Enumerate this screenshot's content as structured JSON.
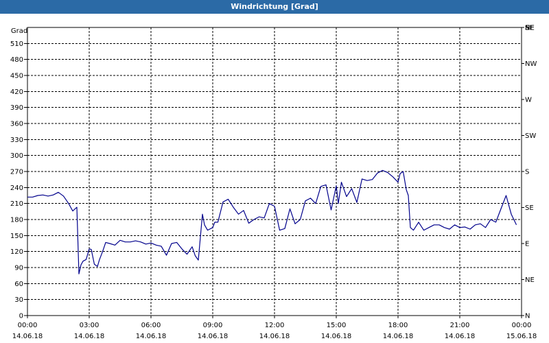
{
  "title": "Windrichtung [Grad]",
  "chart_data": {
    "type": "line",
    "title": "Windrichtung [Grad]",
    "ylabel": "Grad",
    "xlabel": "",
    "ylim": [
      0,
      540
    ],
    "yticks": [
      0,
      30,
      60,
      90,
      120,
      150,
      180,
      210,
      240,
      270,
      300,
      330,
      360,
      390,
      420,
      450,
      480,
      510
    ],
    "right_axis_labels": [
      {
        "value": 0,
        "label": "N"
      },
      {
        "value": 45,
        "label": "NE"
      },
      {
        "value": 90,
        "label": "E"
      },
      {
        "value": 135,
        "label": "SE"
      },
      {
        "value": 180,
        "label": "S"
      },
      {
        "value": 225,
        "label": "SW"
      },
      {
        "value": 270,
        "label": "W"
      },
      {
        "value": 315,
        "label": "NW"
      },
      {
        "value": 360,
        "label": "N"
      },
      {
        "value": 405,
        "label": "NE"
      },
      {
        "value": 450,
        "label": "E"
      },
      {
        "value": 495,
        "label": "SE"
      },
      {
        "value": 540,
        "label": "S"
      }
    ],
    "xlim": [
      "14.06.18 00:00",
      "15.06.18 00:00"
    ],
    "xticks": [
      {
        "time": "00:00",
        "date": "14.06.18"
      },
      {
        "time": "03:00",
        "date": "14.06.18"
      },
      {
        "time": "06:00",
        "date": "14.06.18"
      },
      {
        "time": "09:00",
        "date": "14.06.18"
      },
      {
        "time": "12:00",
        "date": "14.06.18"
      },
      {
        "time": "15:00",
        "date": "14.06.18"
      },
      {
        "time": "18:00",
        "date": "14.06.18"
      },
      {
        "time": "21:00",
        "date": "14.06.18"
      },
      {
        "time": "00:00",
        "date": "15.06.18"
      }
    ],
    "grid": true,
    "line_color": "#00008b",
    "series": [
      {
        "x_hours": [
          0,
          0.25,
          0.5,
          0.75,
          1,
          1.25,
          1.5,
          1.75,
          2,
          2.2,
          2.4,
          2.5,
          2.6,
          2.7,
          2.85,
          3,
          3.1,
          3.25,
          3.4,
          3.5,
          3.65,
          3.8,
          4,
          4.25,
          4.5,
          4.75,
          5,
          5.25,
          5.5,
          5.75,
          6,
          6.25,
          6.5,
          6.75,
          7,
          7.25,
          7.5,
          7.75,
          8,
          8.15,
          8.3,
          8.5,
          8.6,
          8.75,
          9,
          9.1,
          9.25,
          9.5,
          9.6,
          9.75,
          10,
          10.25,
          10.5,
          10.75,
          11,
          11.25,
          11.5,
          11.75,
          12,
          12.25,
          12.5,
          12.75,
          13,
          13.25,
          13.5,
          13.75,
          14,
          14.25,
          14.5,
          14.75,
          15,
          15.1,
          15.25,
          15.5,
          15.75,
          16,
          16.25,
          16.5,
          16.75,
          17,
          17.25,
          17.5,
          17.75,
          18,
          18.1,
          18.25,
          18.4,
          18.5,
          18.6,
          18.75,
          19,
          19.25,
          19.5,
          19.75,
          20,
          20.25,
          20.5,
          20.75,
          21,
          21.25,
          21.5,
          21.75,
          22,
          22.25,
          22.5,
          22.75,
          23,
          23.25,
          23.5,
          23.75,
          24
        ],
        "values": [
          222,
          222,
          225,
          226,
          224,
          226,
          231,
          224,
          210,
          196,
          203,
          78,
          95,
          102,
          105,
          125,
          124,
          96,
          92,
          105,
          120,
          137,
          135,
          132,
          141,
          138,
          138,
          140,
          138,
          134,
          136,
          132,
          130,
          113,
          135,
          137,
          125,
          115,
          129,
          112,
          104,
          190,
          170,
          160,
          165,
          175,
          175,
          213,
          215,
          218,
          203,
          190,
          197,
          173,
          180,
          185,
          183,
          210,
          205,
          160,
          163,
          200,
          172,
          180,
          215,
          220,
          210,
          242,
          245,
          198,
          243,
          210,
          250,
          223,
          238,
          212,
          256,
          253,
          255,
          267,
          272,
          268,
          260,
          250,
          266,
          270,
          236,
          225,
          165,
          160,
          175,
          160,
          165,
          170,
          170,
          165,
          162,
          170,
          165,
          166,
          162,
          170,
          172,
          165,
          180,
          175,
          200,
          225,
          190,
          170
        ]
      }
    ]
  }
}
